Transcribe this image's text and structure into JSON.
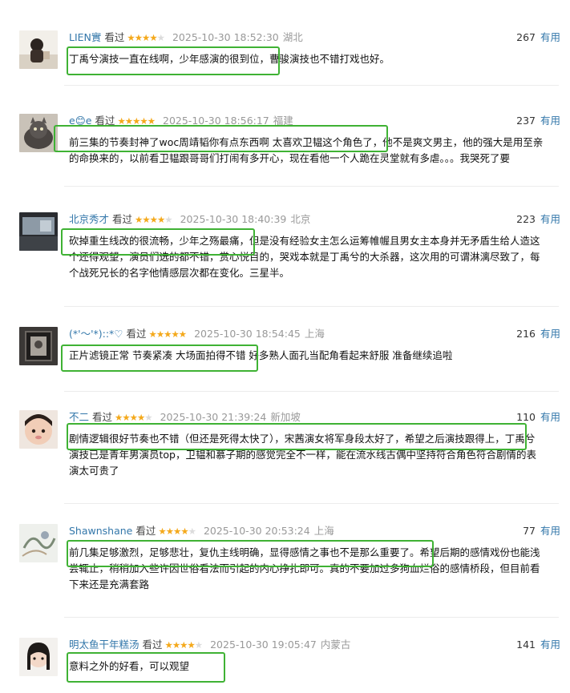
{
  "watched_label": "看过",
  "useful_label": "有用",
  "colors": {
    "star_on": "#f4a91c",
    "star_off": "#dcdcdc",
    "link": "#3377aa",
    "highlight": "#3fb234"
  },
  "reviews": [
    {
      "user": "LIEN實",
      "stars": 4,
      "time": "2025-10-30 18:52:30",
      "location": "湖北",
      "votes": "267",
      "lines": [
        "丁禹兮演技一直在线啊，少年感演的很到位，曹骏演技也不错打戏也好。"
      ]
    },
    {
      "user": "e😊e",
      "stars": 5,
      "time": "2025-10-30 18:56:17",
      "location": "福建",
      "votes": "237",
      "lines": [
        "前三集的节奏封神了woc周靖韬你有点东西啊 太喜欢卫韫这个角色了，他不是爽文男主，他的强大是用至亲",
        "的命换来的，以前看卫韫跟哥哥们打闹有多开心，现在看他一个人跪在灵堂就有多虐。。。我哭死了要"
      ]
    },
    {
      "user": "北京秀才",
      "stars": 4,
      "time": "2025-10-30 18:40:39",
      "location": "北京",
      "votes": "223",
      "lines": [
        "砍掉重生线改的很流畅，少年之殇最痛，但是没有经验女主怎么运筹帷幄且男女主本身并无矛盾生给人造这",
        "个还得观望，演员们选的都不错，赏心悦目的，哭戏本就是丁禹兮的大杀器，这次用的可谓淋漓尽致了，每",
        "个战死兄长的名字他情感层次都在变化。三星半。"
      ]
    },
    {
      "user": "(*'〜'*)::*♡",
      "stars": 5,
      "time": "2025-10-30 18:54:45",
      "location": "上海",
      "votes": "216",
      "lines": [
        "正片滤镜正常 节奏紧凑 大场面拍得不错 好多熟人面孔当配角看起来舒服 准备继续追啦"
      ]
    },
    {
      "user": "不二",
      "stars": 4,
      "time": "2025-10-30 21:39:24",
      "location": "新加坡",
      "votes": "110",
      "lines": [
        "剧情逻辑很好节奏也不错（但还是死得太快了），宋茜演女将军身段太好了，希望之后演技跟得上，丁禹兮",
        "演技已是青年男演员top，卫韫和慕子期的感觉完全不一样，能在流水线古偶中坚持符合角色符合剧情的表",
        "演太可贵了"
      ]
    },
    {
      "user": "Shawnshane",
      "stars": 4,
      "time": "2025-10-30 20:53:24",
      "location": "上海",
      "votes": "77",
      "lines": [
        "前几集足够激烈，足够悲壮，复仇主线明确，显得感情之事也不是那么重要了。希望后期的感情戏份也能浅",
        "尝辄止，稍稍加入些许因世俗看法而引起的内心挣扎即可。真的不要加过多狗血烂俗的感情桥段，但目前看",
        "下来还是充满套路"
      ]
    },
    {
      "user": "明太鱼干年糕汤",
      "stars": 4,
      "time": "2025-10-30 19:05:47",
      "location": "内蒙古",
      "votes": "141",
      "lines": [
        "意料之外的好看，可以观望"
      ]
    }
  ]
}
